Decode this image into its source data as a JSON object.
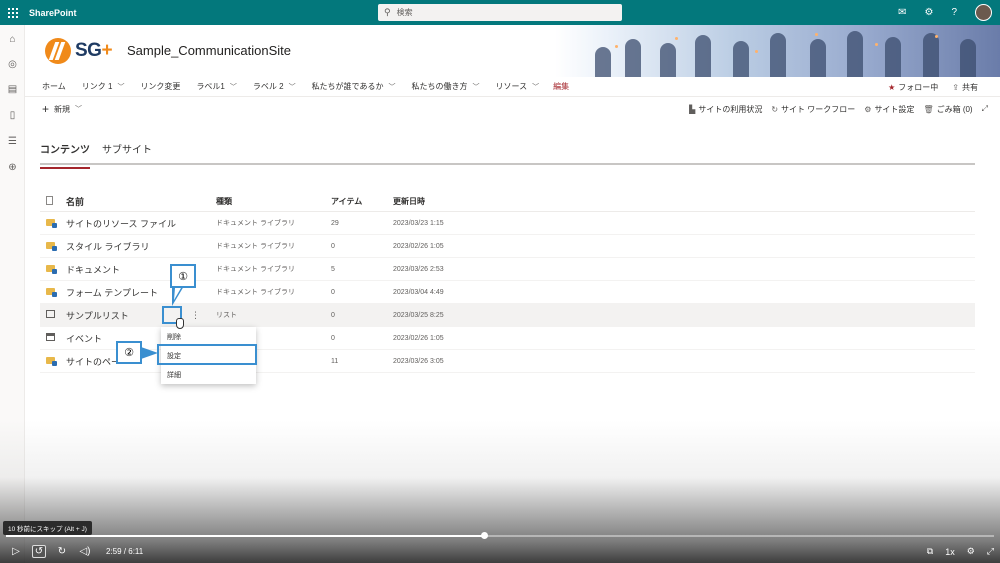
{
  "suite": {
    "app_name": "SharePoint",
    "search_placeholder": "検索"
  },
  "site": {
    "logo_text": "SG",
    "logo_plus": "+",
    "title": "Sample_CommunicationSite"
  },
  "nav": {
    "items": [
      {
        "label": "ホーム",
        "chevron": false
      },
      {
        "label": "リンク 1",
        "chevron": true
      },
      {
        "label": "リンク変更",
        "chevron": false
      },
      {
        "label": "ラベル1",
        "chevron": true
      },
      {
        "label": "ラベル 2",
        "chevron": true
      },
      {
        "label": "私たちが誰であるか",
        "chevron": true
      },
      {
        "label": "私たちの働き方",
        "chevron": true
      },
      {
        "label": "リソース",
        "chevron": true
      }
    ],
    "edit": "編集",
    "follow": "フォロー中",
    "share": "共有"
  },
  "command": {
    "new_label": "新規",
    "usage": "サイトの利用状況",
    "workflow": "サイト ワークフロー",
    "settings": "サイト設定",
    "recycle": "ごみ箱 (0)"
  },
  "pivot": {
    "tabs": [
      "コンテンツ",
      "サブサイト"
    ]
  },
  "table": {
    "headers": {
      "name": "名前",
      "type": "種類",
      "items": "アイテム",
      "modified": "更新日時"
    },
    "rows": [
      {
        "name": "サイトのリソース ファイル",
        "type": "ドキュメント ライブラリ",
        "count": "29",
        "date": "2023/03/23 1:15",
        "icon": "folder-icon"
      },
      {
        "name": "スタイル ライブラリ",
        "type": "ドキュメント ライブラリ",
        "count": "0",
        "date": "2023/02/26 1:05",
        "icon": "folder-icon"
      },
      {
        "name": "ドキュメント",
        "type": "ドキュメント ライブラリ",
        "count": "5",
        "date": "2023/03/26 2:53",
        "icon": "folder-icon"
      },
      {
        "name": "フォーム テンプレート",
        "type": "ドキュメント ライブラリ",
        "count": "0",
        "date": "2023/03/04 4:49",
        "icon": "folder-icon"
      },
      {
        "name": "サンプルリスト",
        "type": "リスト",
        "count": "0",
        "date": "2023/03/25 8:25",
        "icon": "list-icon"
      },
      {
        "name": "イベント",
        "type": "",
        "count": "0",
        "date": "2023/02/26 1:05",
        "icon": "calendar-icon"
      },
      {
        "name": "サイトのペー",
        "type": "",
        "count": "11",
        "date": "2023/03/26 3:05",
        "icon": "folder-icon"
      }
    ]
  },
  "context_menu": {
    "items": [
      "削除",
      "設定",
      "詳細"
    ]
  },
  "annotations": {
    "step1": "①",
    "step2": "②"
  },
  "player": {
    "tooltip": "10 秒前にスキップ (Alt + J)",
    "time": "2:59 / 6:11",
    "progress": 0.484,
    "speed": "1x"
  },
  "colors": {
    "suite_bar": "#03787c",
    "accent": "#a4262c",
    "highlight_box": "#3a8fd0"
  }
}
